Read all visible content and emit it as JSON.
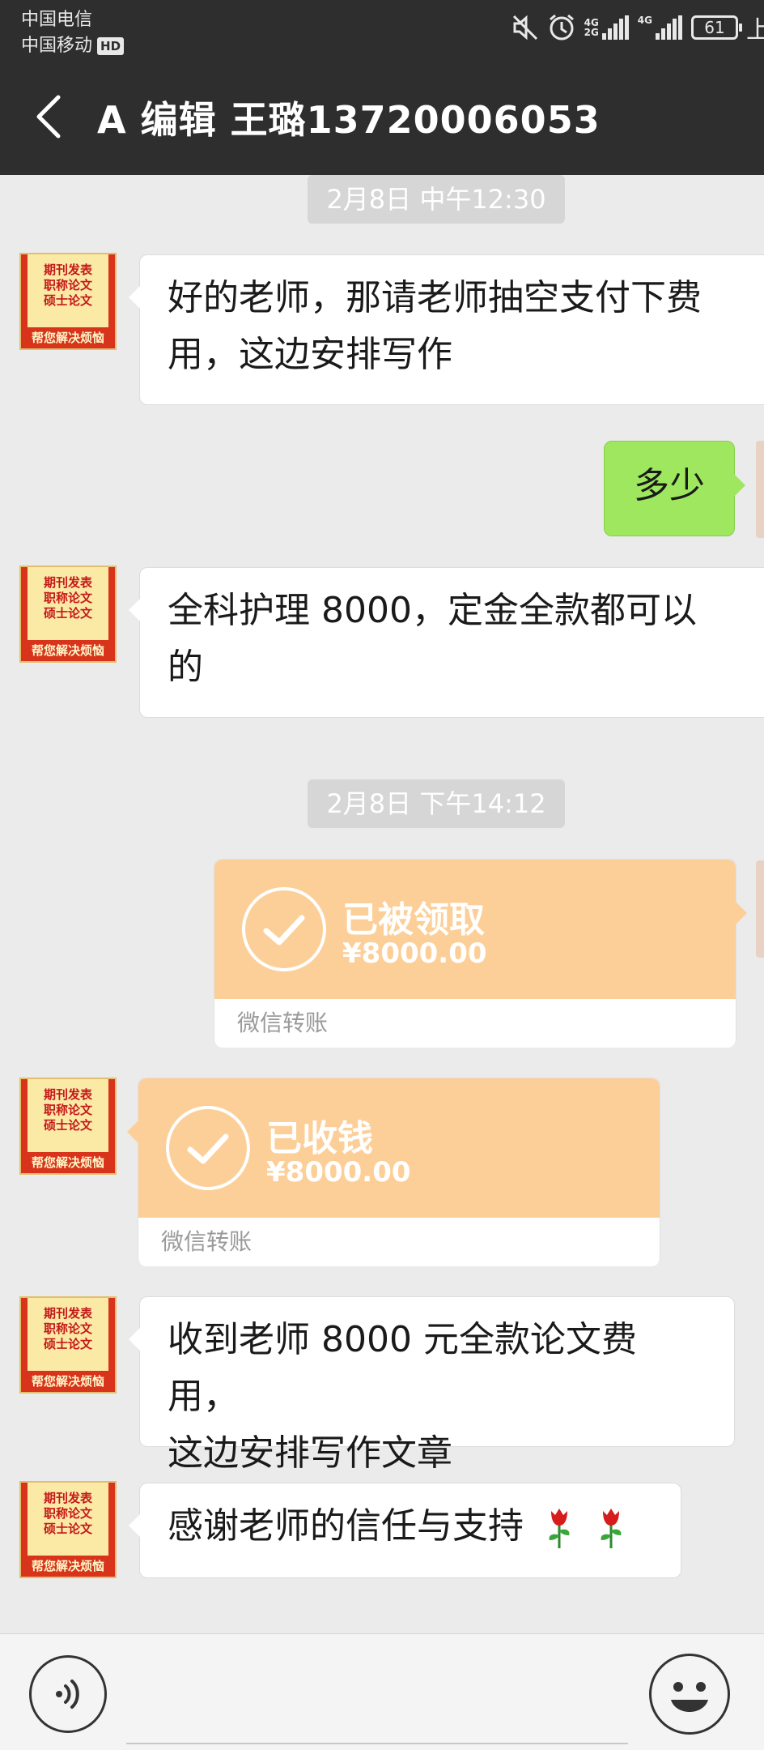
{
  "status_bar": {
    "carrier_1": "中国电信",
    "carrier_2": "中国移动",
    "hd_badge": "HD",
    "network_1": "4G",
    "network_1b": "2G",
    "network_2": "4G",
    "battery": "61",
    "edge_text": "上"
  },
  "header": {
    "title": "A 编辑  王璐13720006053",
    "back_icon": "chevron-left-icon"
  },
  "avatar": {
    "lines": [
      "期刊发表",
      "职称论文",
      "硕士论文"
    ],
    "bottom": "帮您解决烦恼"
  },
  "messages": [
    {
      "type": "timestamp",
      "text": "2月8日 中午12:30"
    },
    {
      "type": "text",
      "side": "in",
      "lines": [
        "好的老师，那请老师抽空支付下费",
        "用，这边安排写作"
      ]
    },
    {
      "type": "text",
      "side": "out",
      "lines": [
        "多少"
      ]
    },
    {
      "type": "text",
      "side": "in",
      "lines": [
        "全科护理 8000，定金全款都可以",
        "的"
      ]
    },
    {
      "type": "timestamp",
      "text": "2月8日 下午14:12"
    },
    {
      "type": "transfer",
      "side": "out",
      "status": "已被领取",
      "amount": "¥8000.00",
      "footer": "微信转账"
    },
    {
      "type": "transfer",
      "side": "in",
      "status": "已收钱",
      "amount": "¥8000.00",
      "footer": "微信转账"
    },
    {
      "type": "text",
      "side": "in",
      "lines": [
        "收到老师 8000 元全款论文费用，",
        "这边安排写作文章"
      ]
    },
    {
      "type": "text",
      "side": "in",
      "lines": [
        "感谢老师的信任与支持"
      ],
      "emoji": [
        "rose-icon",
        "rose-icon"
      ]
    }
  ],
  "input_bar": {
    "voice_icon": "voice-icon",
    "emoji_icon": "smiley-icon",
    "text_value": ""
  },
  "colors": {
    "header_bg": "#2e2e2e",
    "chat_bg": "#ebebeb",
    "outgoing_bubble": "#9ee75e",
    "transfer_orange": "#fdcf98"
  }
}
